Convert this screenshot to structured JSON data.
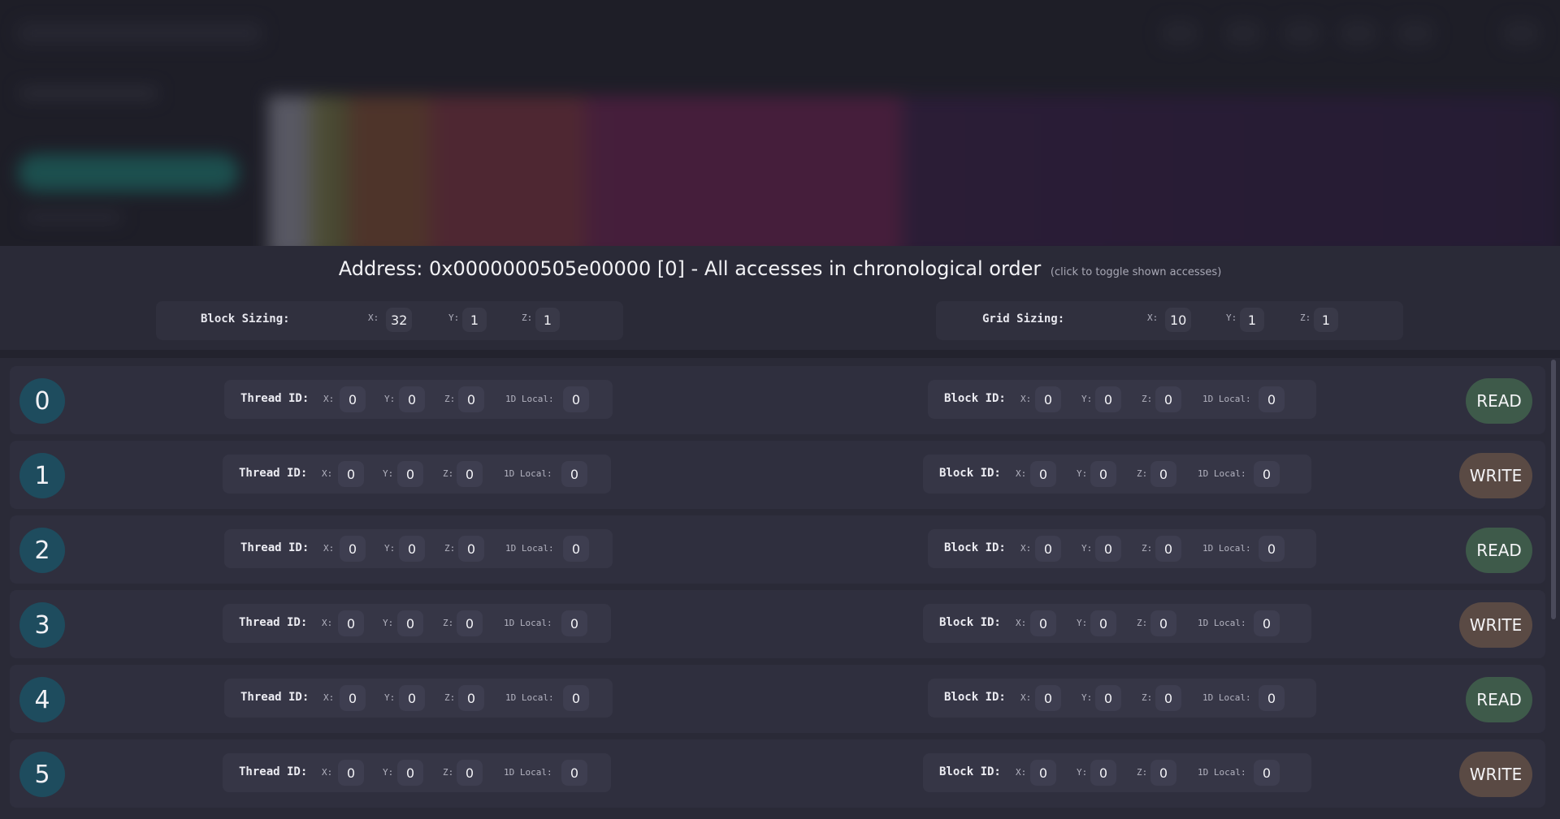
{
  "title": {
    "main": "Address: 0x0000000505e00000 [0] - All accesses in chronological order",
    "hint": "(click to toggle shown accesses)"
  },
  "block_sizing": {
    "label": "Block Sizing:",
    "x_label": "X:",
    "y_label": "Y:",
    "z_label": "Z:",
    "x": "32",
    "y": "1",
    "z": "1"
  },
  "grid_sizing": {
    "label": "Grid Sizing:",
    "x_label": "X:",
    "y_label": "Y:",
    "z_label": "Z:",
    "x": "10",
    "y": "1",
    "z": "1"
  },
  "labels": {
    "thread": "Thread ID:",
    "block": "Block ID:",
    "x": "X:",
    "y": "Y:",
    "z": "Z:",
    "local": "1D Local:"
  },
  "colors": {
    "read": "#3e5a4a",
    "write": "#5a4a44",
    "index_circle": "#1e4c5e"
  },
  "accesses": [
    {
      "index": "0",
      "thread": {
        "x": "0",
        "y": "0",
        "z": "0",
        "local": "0"
      },
      "block": {
        "x": "0",
        "y": "0",
        "z": "0",
        "local": "0"
      },
      "op": "READ"
    },
    {
      "index": "1",
      "thread": {
        "x": "0",
        "y": "0",
        "z": "0",
        "local": "0"
      },
      "block": {
        "x": "0",
        "y": "0",
        "z": "0",
        "local": "0"
      },
      "op": "WRITE"
    },
    {
      "index": "2",
      "thread": {
        "x": "0",
        "y": "0",
        "z": "0",
        "local": "0"
      },
      "block": {
        "x": "0",
        "y": "0",
        "z": "0",
        "local": "0"
      },
      "op": "READ"
    },
    {
      "index": "3",
      "thread": {
        "x": "0",
        "y": "0",
        "z": "0",
        "local": "0"
      },
      "block": {
        "x": "0",
        "y": "0",
        "z": "0",
        "local": "0"
      },
      "op": "WRITE"
    },
    {
      "index": "4",
      "thread": {
        "x": "0",
        "y": "0",
        "z": "0",
        "local": "0"
      },
      "block": {
        "x": "0",
        "y": "0",
        "z": "0",
        "local": "0"
      },
      "op": "READ"
    },
    {
      "index": "5",
      "thread": {
        "x": "0",
        "y": "0",
        "z": "0",
        "local": "0"
      },
      "block": {
        "x": "0",
        "y": "0",
        "z": "0",
        "local": "0"
      },
      "op": "WRITE"
    }
  ]
}
